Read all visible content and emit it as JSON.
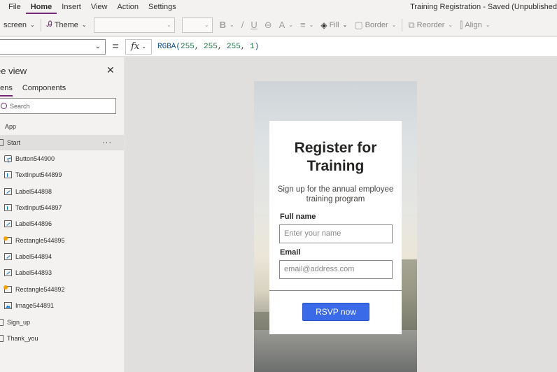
{
  "menu": {
    "items": [
      "File",
      "Home",
      "Insert",
      "View",
      "Action",
      "Settings"
    ],
    "active": "Home",
    "app_title": "Training Registration - Saved (Unpublished"
  },
  "toolbar": {
    "screen_label": "screen",
    "theme_label": "Theme",
    "bold_glyph": "B",
    "italic_glyph": "/",
    "underline_glyph": "U",
    "fill_label": "Fill",
    "border_label": "Border",
    "reorder_label": "Reorder",
    "align_label": "Align"
  },
  "formula_bar": {
    "equals": "=",
    "fx_label": "fx",
    "formula_fn": "RGBA(",
    "formula_args": [
      "255",
      "255",
      "255",
      "1"
    ],
    "formula_close": ")"
  },
  "tree_view": {
    "title": "ee view",
    "tabs": [
      "eens",
      "Components"
    ],
    "search_placeholder": "Search",
    "items": [
      {
        "label": "App",
        "icon": "app-icon"
      },
      {
        "label": "Start",
        "icon": "screen-icon",
        "selected": true,
        "more": "···"
      },
      {
        "label": "Button544900",
        "icon": "button-icon"
      },
      {
        "label": "TextInput544899",
        "icon": "text-input-icon"
      },
      {
        "label": "Label544898",
        "icon": "label-icon"
      },
      {
        "label": "TextInput544897",
        "icon": "text-input-icon"
      },
      {
        "label": "Label544896",
        "icon": "label-icon"
      },
      {
        "label": "Rectangle544895",
        "icon": "rectangle-icon"
      },
      {
        "label": "Label544894",
        "icon": "label-icon"
      },
      {
        "label": "Label544893",
        "icon": "label-icon"
      },
      {
        "label": "Rectangle544892",
        "icon": "rectangle-icon"
      },
      {
        "label": "Image544891",
        "icon": "image-icon"
      },
      {
        "label": "Sign_up",
        "icon": "screen-icon"
      },
      {
        "label": "Thank_you",
        "icon": "screen-icon"
      }
    ]
  },
  "form": {
    "title": "Register for Training",
    "subtitle": "Sign up for the annual employee training program",
    "name_label": "Full name",
    "name_placeholder": "Enter your name",
    "email_label": "Email",
    "email_placeholder": "email@address.com",
    "button_label": "RSVP now"
  },
  "colors": {
    "accent": "#742774",
    "button": "#3a6ae8"
  }
}
